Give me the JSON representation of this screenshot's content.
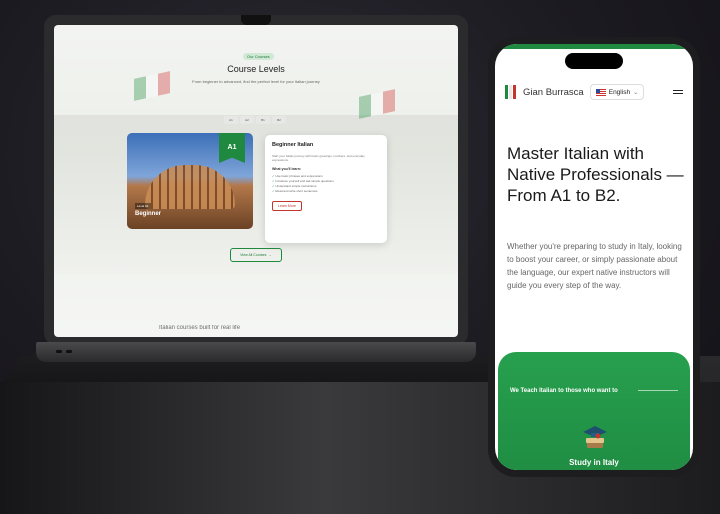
{
  "laptop": {
    "badge": "Our Courses",
    "section_title": "Course Levels",
    "section_subtitle": "From beginner to advanced, find the perfect level for your Italian journey",
    "level_tabs": [
      "A1",
      "A2",
      "B1",
      "B2"
    ],
    "card": {
      "ribbon": "A1",
      "level_small": "Level A1",
      "level_big": "Beginner",
      "title": "Beginner Italian",
      "description": "Start your Italian journey with basic greetings, numbers, and everyday expressions.",
      "learn_heading": "What you'll learn:",
      "learn_items": [
        "Use basic phrases and expressions",
        "Introduce yourself and ask simple questions",
        "Understand simple instructions",
        "Read and write short sentences"
      ],
      "button": "Learn More"
    },
    "view_all": "View All Courses",
    "view_all_arrow": "→",
    "bottom_text": "Italian courses built for real life"
  },
  "phone": {
    "brand": "Gian Burrasca",
    "language": "English",
    "language_chevron": "⌄",
    "hero": "Master Italian with Native Professionals — From A1 to B2.",
    "body": "Whether you're preparing to study in Italy, looking to boost your career, or simply passionate about the language, our expert native instructors will guide you every step of the way.",
    "section_label": "We Teach Italian to those who want to",
    "card_label": "Study in Italy"
  },
  "colors": {
    "brand_green": "#1f8a3f",
    "accent_red": "#c4352b"
  }
}
